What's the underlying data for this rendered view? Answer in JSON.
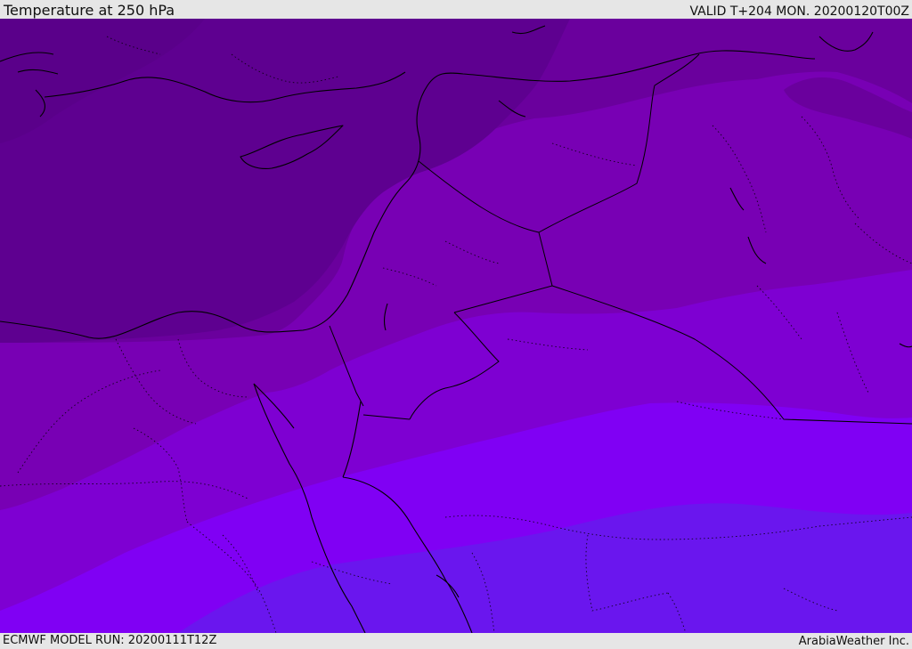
{
  "header": {
    "title": "Temperature at 250 hPa",
    "valid": "VALID T+204 MON. 20200120T00Z"
  },
  "footer": {
    "model_run": "ECMWF MODEL RUN: 20200111T12Z",
    "credit": "ArabiaWeather Inc."
  },
  "map": {
    "field": "temperature",
    "level": "250 hPa",
    "shading_colors": [
      "#5e0090",
      "#6a009d",
      "#7800b4",
      "#7e00d2",
      "#8000f4",
      "#6a16ee"
    ],
    "line_color": "#000000"
  }
}
